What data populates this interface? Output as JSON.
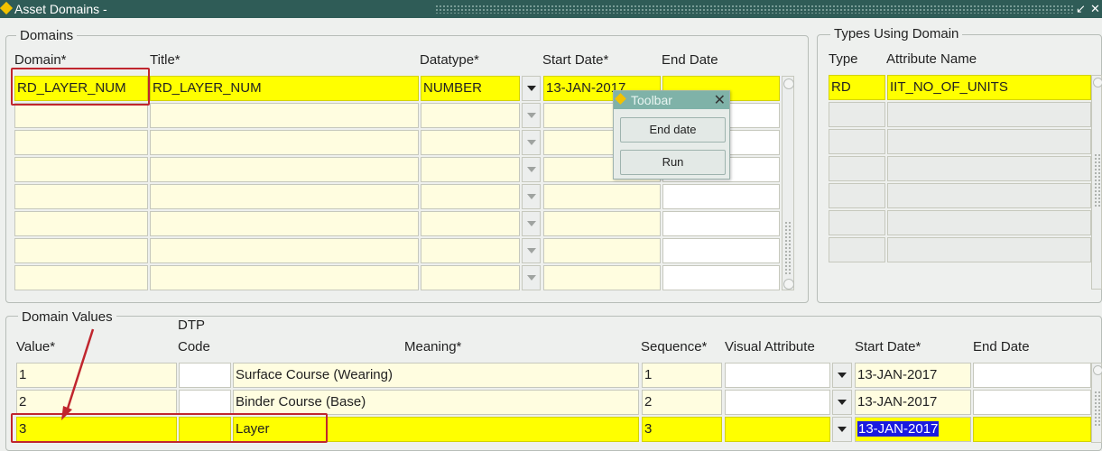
{
  "window": {
    "title": "Asset Domains -",
    "minimize": "↙",
    "close": "✕"
  },
  "domains": {
    "legend": "Domains",
    "headers": {
      "domain": "Domain*",
      "title": "Title*",
      "datatype": "Datatype*",
      "start_date": "Start Date*",
      "end_date": "End Date"
    },
    "rows": [
      {
        "domain": "RD_LAYER_NUM",
        "title": "RD_LAYER_NUM",
        "datatype": "NUMBER",
        "start_date": "13-JAN-2017",
        "end_date": ""
      },
      {
        "domain": "",
        "title": "",
        "datatype": "",
        "start_date": "",
        "end_date": ""
      },
      {
        "domain": "",
        "title": "",
        "datatype": "",
        "start_date": "",
        "end_date": ""
      },
      {
        "domain": "",
        "title": "",
        "datatype": "",
        "start_date": "",
        "end_date": ""
      },
      {
        "domain": "",
        "title": "",
        "datatype": "",
        "start_date": "",
        "end_date": ""
      },
      {
        "domain": "",
        "title": "",
        "datatype": "",
        "start_date": "",
        "end_date": ""
      },
      {
        "domain": "",
        "title": "",
        "datatype": "",
        "start_date": "",
        "end_date": ""
      },
      {
        "domain": "",
        "title": "",
        "datatype": "",
        "start_date": "",
        "end_date": ""
      }
    ]
  },
  "types": {
    "legend": "Types Using Domain",
    "headers": {
      "type": "Type",
      "attribute": "Attribute Name"
    },
    "rows": [
      {
        "type": "RD",
        "attribute": "IIT_NO_OF_UNITS"
      },
      {
        "type": "",
        "attribute": ""
      },
      {
        "type": "",
        "attribute": ""
      },
      {
        "type": "",
        "attribute": ""
      },
      {
        "type": "",
        "attribute": ""
      },
      {
        "type": "",
        "attribute": ""
      },
      {
        "type": "",
        "attribute": ""
      }
    ]
  },
  "toolbar": {
    "title": "Toolbar",
    "close": "✕",
    "end_date_label": "End date",
    "run_label": "Run"
  },
  "domain_values": {
    "legend": "Domain Values",
    "headers": {
      "value": "Value*",
      "dtp_line1": "DTP",
      "dtp_line2": "Code",
      "meaning": "Meaning*",
      "sequence": "Sequence*",
      "visual": "Visual Attribute",
      "start_date": "Start Date*",
      "end_date": "End Date"
    },
    "rows": [
      {
        "value": "1",
        "dtp": "",
        "meaning": "Surface Course (Wearing)",
        "sequence": "1",
        "visual": "",
        "start_date": "13-JAN-2017",
        "end_date": ""
      },
      {
        "value": "2",
        "dtp": "",
        "meaning": "Binder Course (Base)",
        "sequence": "2",
        "visual": "",
        "start_date": "13-JAN-2017",
        "end_date": ""
      },
      {
        "value": "3",
        "dtp": "",
        "meaning": "Layer",
        "sequence": "3",
        "visual": "",
        "start_date": "13-JAN-2017",
        "end_date": ""
      }
    ]
  },
  "colors": {
    "title_bar": "#2f5c57",
    "required": "#fffde0",
    "current_record": "#ffff00",
    "annotation": "#c0262e"
  }
}
